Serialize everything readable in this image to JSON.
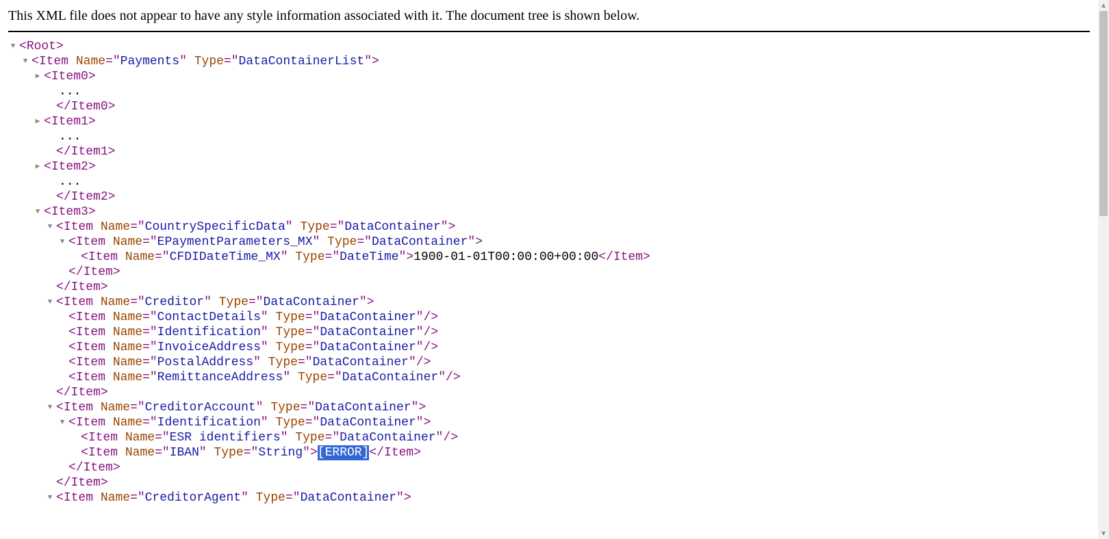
{
  "header": "This XML file does not appear to have any style information associated with it. The document tree is shown below.",
  "attr": {
    "name": "Name",
    "type": "Type"
  },
  "root": "Root",
  "payments": {
    "tag": "Item",
    "name": "Payments",
    "type": "DataContainerList"
  },
  "item0": {
    "open": "Item0",
    "close": "/Item0",
    "dots": "..."
  },
  "item1": {
    "open": "Item1",
    "close": "/Item1",
    "dots": "..."
  },
  "item2": {
    "open": "Item2",
    "close": "/Item2",
    "dots": "..."
  },
  "item3": {
    "open": "Item3"
  },
  "csd": {
    "tag": "Item",
    "name": "CountrySpecificData",
    "type": "DataContainer"
  },
  "epm": {
    "tag": "Item",
    "name": "EPaymentParameters_MX",
    "type": "DataContainer"
  },
  "cfdi": {
    "tag": "Item",
    "name": "CFDIDateTime_MX",
    "type": "DateTime",
    "value": "1900-01-01T00:00:00+00:00",
    "close": "/Item"
  },
  "closeItem": "/Item",
  "creditor": {
    "tag": "Item",
    "name": "Creditor",
    "type": "DataContainer"
  },
  "cred_children": [
    {
      "name": "ContactDetails",
      "type": "DataContainer"
    },
    {
      "name": "Identification",
      "type": "DataContainer"
    },
    {
      "name": "InvoiceAddress",
      "type": "DataContainer"
    },
    {
      "name": "PostalAddress",
      "type": "DataContainer"
    },
    {
      "name": "RemittanceAddress",
      "type": "DataContainer"
    }
  ],
  "credacct": {
    "tag": "Item",
    "name": "CreditorAccount",
    "type": "DataContainer"
  },
  "ident": {
    "tag": "Item",
    "name": "Identification",
    "type": "DataContainer"
  },
  "esr": {
    "tag": "Item",
    "name": "ESR identifiers",
    "type": "DataContainer"
  },
  "iban": {
    "tag": "Item",
    "name": "IBAN",
    "type": "String",
    "value": "[ERROR]",
    "close": "/Item"
  },
  "credagent": {
    "tag": "Item",
    "name": "CreditorAgent",
    "type": "DataContainer"
  },
  "glyph": {
    "down": "▼",
    "right": "▶"
  }
}
